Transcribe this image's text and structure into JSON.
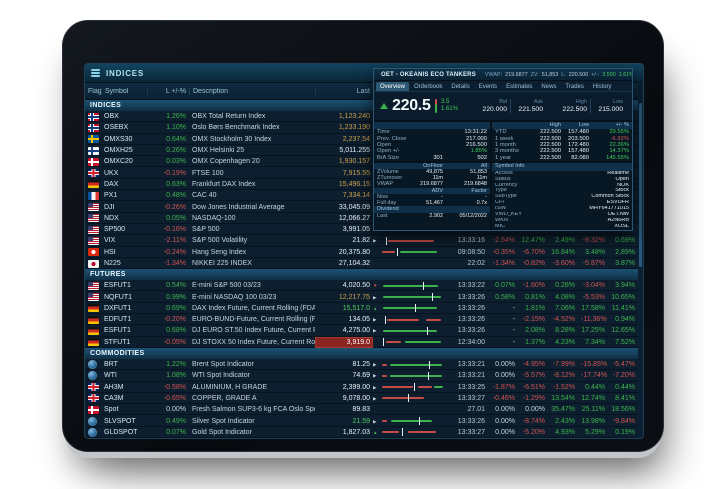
{
  "indices_window": {
    "title": "INDICES",
    "columns": [
      "Flag",
      "Symbol",
      "L +/-%",
      "Description",
      "Last",
      "L"
    ],
    "sections": [
      {
        "label": "INDICES",
        "rows": [
          {
            "flag": "norway",
            "symbol": "OBX",
            "pct": "1.26%",
            "desc": "OBX Total Return Index",
            "last": "1,123.240",
            "lastStyle": "la",
            "arrow": "down",
            "spark": null,
            "time": "",
            "p": [
              "",
              "",
              "",
              "",
              ""
            ]
          },
          {
            "flag": "norway",
            "symbol": "OSEBX",
            "pct": "1.10%",
            "desc": "Oslo Børs Benchmark Index",
            "last": "1,233.190",
            "lastStyle": "la",
            "arrow": "down",
            "spark": null,
            "time": "",
            "p": [
              "",
              "",
              "",
              "",
              ""
            ]
          },
          {
            "flag": "sweden",
            "symbol": "OMXS30",
            "pct": "0.64%",
            "desc": "OMX Stockholm 30 Index",
            "last": "2,237.54",
            "lastStyle": "la",
            "arrow": "down",
            "spark": null,
            "time": "",
            "p": [
              "",
              "",
              "",
              "",
              ""
            ]
          },
          {
            "flag": "finland",
            "symbol": "OMXH25",
            "pct": "0.26%",
            "desc": "OMX Helsinki 25",
            "last": "5,011.255",
            "lastStyle": "lw",
            "arrow": "down",
            "spark": null,
            "time": "",
            "p": [
              "",
              "",
              "",
              "",
              ""
            ]
          },
          {
            "flag": "denmark",
            "symbol": "OMXC20",
            "pct": "0.03%",
            "desc": "OMX Copenhagen 20",
            "last": "1,930.157",
            "lastStyle": "la",
            "arrow": "down",
            "spark": null,
            "time": "",
            "p": [
              "",
              "",
              "",
              "",
              ""
            ]
          },
          {
            "flag": "uk",
            "symbol": "UKX",
            "pct": "-0.19%",
            "desc": "FTSE 100",
            "last": "7,915.55",
            "lastStyle": "la",
            "arrow": "down",
            "spark": null,
            "time": "",
            "p": [
              "",
              "",
              "",
              "",
              ""
            ]
          },
          {
            "flag": "germany",
            "symbol": "DAX",
            "pct": "0.63%",
            "desc": "Frankfurt DAX Index",
            "last": "15,496.15",
            "lastStyle": "la",
            "arrow": "up",
            "spark": null,
            "time": "",
            "p": [
              "",
              "",
              "",
              "",
              ""
            ]
          },
          {
            "flag": "france",
            "symbol": "PX1",
            "pct": "0.48%",
            "desc": "CAC 40",
            "last": "7,334.14",
            "lastStyle": "la",
            "arrow": "down",
            "spark": null,
            "time": "",
            "p": [
              "",
              "",
              "",
              "",
              ""
            ]
          },
          {
            "flag": "usa",
            "symbol": "DJI",
            "pct": "-0.26%",
            "desc": "Dow Jones Industrial Average",
            "last": "33,045.09",
            "lastStyle": "lw",
            "arrow": "none",
            "spark": null,
            "time": "",
            "p": [
              "",
              "",
              "",
              "",
              ""
            ]
          },
          {
            "flag": "usa",
            "symbol": "NDX",
            "pct": "0.05%",
            "desc": "NASDAQ-100",
            "last": "12,066.27",
            "lastStyle": "lw",
            "arrow": "none",
            "spark": null,
            "time": "",
            "p": [
              "",
              "",
              "",
              "",
              ""
            ]
          },
          {
            "flag": "usa",
            "symbol": "SP500",
            "pct": "-0.16%",
            "desc": "S&P 500",
            "last": "3,991.05",
            "lastStyle": "lw",
            "arrow": "none",
            "spark": null,
            "time": "",
            "p": [
              "",
              "",
              "",
              "",
              ""
            ]
          },
          {
            "flag": "usa",
            "symbol": "VIX",
            "pct": "-2.11%",
            "desc": "S&P 500 Volatility",
            "last": "21.82",
            "lastStyle": "lw",
            "arrow": "right",
            "spark": {
              "bars": [
                [
                  "r",
                  10,
                  72
                ]
              ],
              "tick": 6
            },
            "time": "13:33:16",
            "p": [
              "-2.54%",
              "12.47%",
              "2.49%",
              "-8.32%",
              "0.69%"
            ]
          },
          {
            "flag": "hongkong",
            "symbol": "HSI",
            "pct": "-0.24%",
            "desc": "Hang Seng Index",
            "last": "20,375.80",
            "lastStyle": "lw",
            "arrow": "none",
            "spark": {
              "bars": [
                [
                  "r",
                  0,
                  20
                ],
                [
                  "g",
                  28,
                  58
                ]
              ],
              "tick": 24
            },
            "time": "09:08:50",
            "p": [
              "-0.35%",
              "-6.70%",
              "16.84%",
              "3.48%",
              "2.89%"
            ]
          },
          {
            "flag": "japan",
            "symbol": "N225",
            "pct": "-1.34%",
            "desc": "NIKKEI 225 INDEX",
            "last": "27,104.32",
            "lastStyle": "lw",
            "arrow": "none",
            "spark": null,
            "time": "22:02",
            "p": [
              "-1.34%",
              "-0.82%",
              "-3.60%",
              "-5.87%",
              "3.87%"
            ]
          }
        ]
      },
      {
        "label": "FUTURES",
        "rows": [
          {
            "flag": "usa",
            "symbol": "ESFUT1",
            "pct": "0.54%",
            "desc": "E-mini S&P 500 03/23",
            "last": "4,020.50",
            "lastStyle": "lw",
            "arrow": "down",
            "spark": {
              "bars": [
                [
                  "g",
                  2,
                  86
                ]
              ],
              "tick": 64
            },
            "time": "13:33:22",
            "p": [
              "0.07%",
              "-1.60%",
              "0.28%",
              "-3.04%",
              "3.94%"
            ]
          },
          {
            "flag": "usa",
            "symbol": "NQFUT1",
            "pct": "0.99%",
            "desc": "E-mini NASDAQ 100 03/23",
            "last": "12,217.75",
            "lastStyle": "la",
            "arrow": "right",
            "spark": {
              "bars": [
                [
                  "g",
                  2,
                  90
                ]
              ],
              "tick": 78
            },
            "time": "13:33:26",
            "p": [
              "0.58%",
              "0.81%",
              "4.08%",
              "-5.53%",
              "10.65%"
            ]
          },
          {
            "flag": "germany",
            "symbol": "DXFUT1",
            "pct": "0.69%",
            "desc": "DAX Index Future, Current Rolling (FDAXH3)",
            "last": "15,517.0",
            "lastStyle": "lg",
            "arrow": "up",
            "spark": {
              "bars": [
                [
                  "g",
                  2,
                  84
                ]
              ],
              "tick": 52
            },
            "time": "13:33:26",
            "p": [
              "-",
              "1.81%",
              "7.06%",
              "17.58%",
              "11.41%"
            ]
          },
          {
            "flag": "germany",
            "symbol": "EDFUT1",
            "pct": "-0.20%",
            "desc": "EURO-BUND-Future, Current Rolling (FGBLH3)",
            "last": "134.05",
            "lastStyle": "lw",
            "arrow": "right",
            "spark": {
              "bars": [
                [
                  "r",
                  8,
                  50
                ],
                [
                  "r",
                  68,
                  24
                ]
              ],
              "tick": 4
            },
            "time": "13:33:26",
            "p": [
              "-",
              "-2.15%",
              "-4.52%",
              "-11.36%",
              "0.94%"
            ]
          },
          {
            "flag": "germany",
            "symbol": "ESFUT1",
            "pct": "0.68%",
            "desc": "DJ EURO ST.50 Index Future, Current Rolling (FESXH3)",
            "last": "4,275.00",
            "lastStyle": "lw",
            "arrow": "right",
            "spark": {
              "bars": [
                [
                  "g",
                  2,
                  84
                ]
              ],
              "tick": 70
            },
            "time": "13:33:26",
            "p": [
              "-",
              "2.08%",
              "8.28%",
              "17.25%",
              "12.65%"
            ]
          },
          {
            "flag": "germany",
            "symbol": "STFUT1",
            "pct": "-0.05%",
            "desc": "DJ STOXX 50 Index Future, Current Rolling (FSTXH3)",
            "last": "3,919.0",
            "lastStyle": "lw",
            "highlight": true,
            "arrow": "none",
            "spark": {
              "bars": [
                [
                  "r",
                  6,
                  24
                ],
                [
                  "g",
                  36,
                  56
                ]
              ],
              "tick": 2
            },
            "time": "12:34:00",
            "p": [
              "-",
              "1.37%",
              "4.23%",
              "7.34%",
              "7.52%"
            ]
          }
        ]
      },
      {
        "label": "COMMODITIES",
        "rows": [
          {
            "flag": "globe",
            "symbol": "BRT",
            "pct": "1.22%",
            "desc": "Brent Spot Indicator",
            "last": "81.25",
            "lastStyle": "lw",
            "arrow": "right",
            "spark": {
              "bars": [
                [
                  "r",
                  0,
                  8
                ],
                [
                  "g",
                  12,
                  82
                ]
              ],
              "tick": 74
            },
            "time": "13:33:21",
            "p": [
              "0.00%",
              "-4.95%",
              "-7.99%",
              "-15.85%",
              "-5.47%"
            ]
          },
          {
            "flag": "globe",
            "symbol": "WTI",
            "pct": "1.08%",
            "desc": "WTI Spot Indicator",
            "last": "74.69",
            "lastStyle": "lw",
            "arrow": "right",
            "spark": {
              "bars": [
                [
                  "r",
                  0,
                  8
                ],
                [
                  "g",
                  12,
                  82
                ]
              ],
              "tick": 72
            },
            "time": "13:33:21",
            "p": [
              "0.00%",
              "-5.57%",
              "-8.12%",
              "-17.74%",
              "-7.20%"
            ]
          },
          {
            "flag": "uk",
            "symbol": "AH3M",
            "pct": "-0.58%",
            "desc": "ALUMINIUM, H GRADE",
            "last": "2,399.00",
            "lastStyle": "lw",
            "arrow": "right",
            "spark": {
              "bars": [
                [
                  "r",
                  0,
                  48
                ],
                [
                  "r",
                  56,
                  22
                ],
                [
                  "g",
                  82,
                  14
                ]
              ],
              "tick": 50
            },
            "time": "13:33:25",
            "p": [
              "-1.87%",
              "-6.51%",
              "-1.52%",
              "0.44%",
              "0.44%"
            ]
          },
          {
            "flag": "uk",
            "symbol": "CA3M",
            "pct": "-0.65%",
            "desc": "COPPER, GRADE A",
            "last": "9,078.00",
            "lastStyle": "lw",
            "arrow": "right",
            "spark": {
              "bars": [
                [
                  "r",
                  0,
                  66
                ]
              ],
              "tick": 40
            },
            "time": "13:33:27",
            "p": [
              "-0.46%",
              "-1.29%",
              "13.54%",
              "12.74%",
              "8.41%"
            ]
          },
          {
            "flag": "denmark",
            "symbol": "Spot",
            "pct": "0.00%",
            "desc": "Fresh Salmon SUP3-6 kg FCA Oslo Spot",
            "last": "89.83",
            "lastStyle": "lw",
            "arrow": "none",
            "spark": null,
            "time": "27.01",
            "p": [
              "0.00%",
              "0.00%",
              "35.47%",
              "25.11%",
              "18.56%"
            ]
          },
          {
            "flag": "globe",
            "symbol": "SLVSPOT",
            "pct": "0.49%",
            "desc": "Silver Spot Indicator",
            "last": "21.59",
            "lastStyle": "lg",
            "arrow": "right",
            "spark": {
              "bars": [
                [
                  "r",
                  0,
                  8
                ],
                [
                  "g",
                  14,
                  64
                ]
              ],
              "tick": 58
            },
            "time": "13:33:26",
            "p": [
              "0.00%",
              "-8.74%",
              "2.43%",
              "13.98%",
              "-9.84%"
            ]
          },
          {
            "flag": "globe",
            "symbol": "GLDSPOT",
            "pct": "0.07%",
            "desc": "Gold Spot Indicator",
            "last": "1,827.03",
            "lastStyle": "lw",
            "arrow": "up",
            "spark": {
              "bars": [
                [
                  "r",
                  0,
                  26
                ],
                [
                  "r",
                  40,
                  44
                ]
              ],
              "tick": 32
            },
            "time": "13:33:27",
            "p": [
              "0.00%",
              "-5.20%",
              "4.93%",
              "5.29%",
              "0.19%"
            ]
          }
        ]
      }
    ]
  },
  "detail_window": {
    "title": "OET - OKEANIS ECO TANKERS",
    "header_stats": {
      "vwap_label": "VWAP:",
      "vwap": "219.6877",
      "zv_label": "ZV:",
      "zv": "51,853",
      "l_label": "L:",
      "l": "220.500",
      "chg_label": "+/-:",
      "chg": "3.500",
      "chg_pct": "1.61%"
    },
    "tabs": [
      "Overview",
      "Orderbook",
      "Details",
      "Events",
      "Estimates",
      "News",
      "Trades",
      "History"
    ],
    "active_tab": "Overview",
    "quote": {
      "last": "220.5",
      "change": "3.5",
      "change_pct": "1.61%",
      "bid_label": "Bid",
      "bid": "220.000",
      "ask_label": "Ask",
      "ask": "221.500",
      "high_label": "High",
      "high": "222.500",
      "low_label": "Low",
      "low": "215.000"
    },
    "snapshot": {
      "rows": [
        {
          "label": "Time",
          "value1": "",
          "value2": "13:31:22"
        },
        {
          "label": "Prev. Close",
          "value1": "",
          "value2": "217.000"
        },
        {
          "label": "Open",
          "value1": "",
          "value2": "216.500"
        },
        {
          "label": "Open +/-",
          "value1": "",
          "value2": "1.85%"
        },
        {
          "label": "B/A Size",
          "value1": "301",
          "value2": "502"
        }
      ]
    },
    "ranges": {
      "headers": [
        "High",
        "Low",
        "+/- %"
      ],
      "rows": [
        {
          "label": "YTD",
          "high": "222.500",
          "low": "157.480",
          "pct": "29.55%"
        },
        {
          "label": "1 week",
          "high": "222.500",
          "low": "203.500",
          "pct": "-6.92%"
        },
        {
          "label": "1 month",
          "high": "222.500",
          "low": "172.480",
          "pct": "22.36%"
        },
        {
          "label": "3 months",
          "high": "222.500",
          "low": "157.480",
          "pct": "14.37%"
        },
        {
          "label": "1 year",
          "high": "222.500",
          "low": "82.080",
          "pct": "145.55%"
        }
      ]
    },
    "volume": {
      "headers": [
        "OnFloor",
        "All"
      ],
      "rows": [
        {
          "label": "ZVolume",
          "v1": "49,875",
          "v2": "51,853"
        },
        {
          "label": "ZTurnover",
          "v1": "11m",
          "v2": "11m"
        },
        {
          "label": "VWAP",
          "v1": "219.6877",
          "v2": "219.6848"
        }
      ]
    },
    "adv": {
      "headers": [
        "ADV",
        "Factor"
      ],
      "rows": [
        {
          "label": "Now",
          "v1": "-",
          "v2": "-"
        },
        {
          "label": "Full day",
          "v1": "51,467",
          "v2": "0.7x"
        }
      ]
    },
    "dividend": {
      "header": "Dividend",
      "rows": [
        {
          "label": "Last",
          "v1": "2.902",
          "v2": "05/12/2022"
        }
      ]
    },
    "symbol_info": {
      "header": "Symbol Info",
      "rows": [
        {
          "label": "Access",
          "value": "Realtime"
        },
        {
          "label": "Status",
          "value": "Open"
        },
        {
          "label": "Currency",
          "value": "NOK"
        },
        {
          "label": "Type",
          "value": "Stock"
        },
        {
          "label": "SubType",
          "value": "Common Stock"
        },
        {
          "label": "CFI",
          "value": "ESVUFR"
        },
        {
          "label": "ISIN",
          "value": "MHY641771015"
        },
        {
          "label": "VWD_KEY",
          "value": "OET.NW"
        },
        {
          "label": "WKN",
          "value": "A2N6RB"
        },
        {
          "label": "MIC",
          "value": "XOSL"
        }
      ]
    }
  }
}
